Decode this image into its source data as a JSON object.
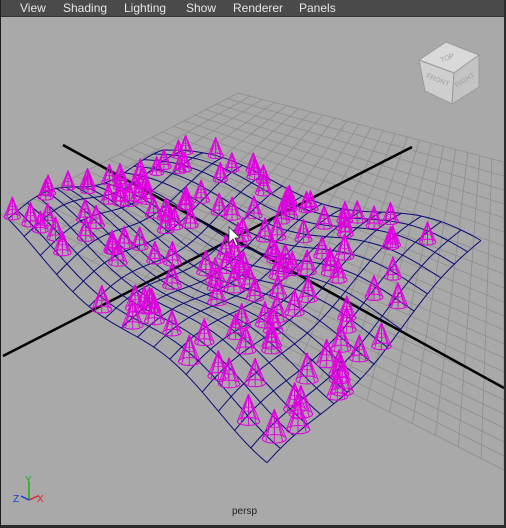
{
  "menu": {
    "items": [
      {
        "label": "View"
      },
      {
        "label": "Shading"
      },
      {
        "label": "Lighting"
      },
      {
        "label": "Show"
      },
      {
        "label": "Renderer"
      },
      {
        "label": "Panels"
      }
    ]
  },
  "viewcube": {
    "top": "TOP",
    "front": "FRONT",
    "right": "RIGHT"
  },
  "axis_gizmo": {
    "x": "X",
    "y": "Y",
    "z": "Z"
  },
  "viewport": {
    "camera_label": "persp"
  },
  "colors": {
    "viewport_bg": "#a9a9a9",
    "grid": "#8e8e8e",
    "axis_lines": "#000000",
    "surface_wire": "#0c0c7a",
    "cones": "#e000e0",
    "menubar": "#4a4a4a"
  }
}
